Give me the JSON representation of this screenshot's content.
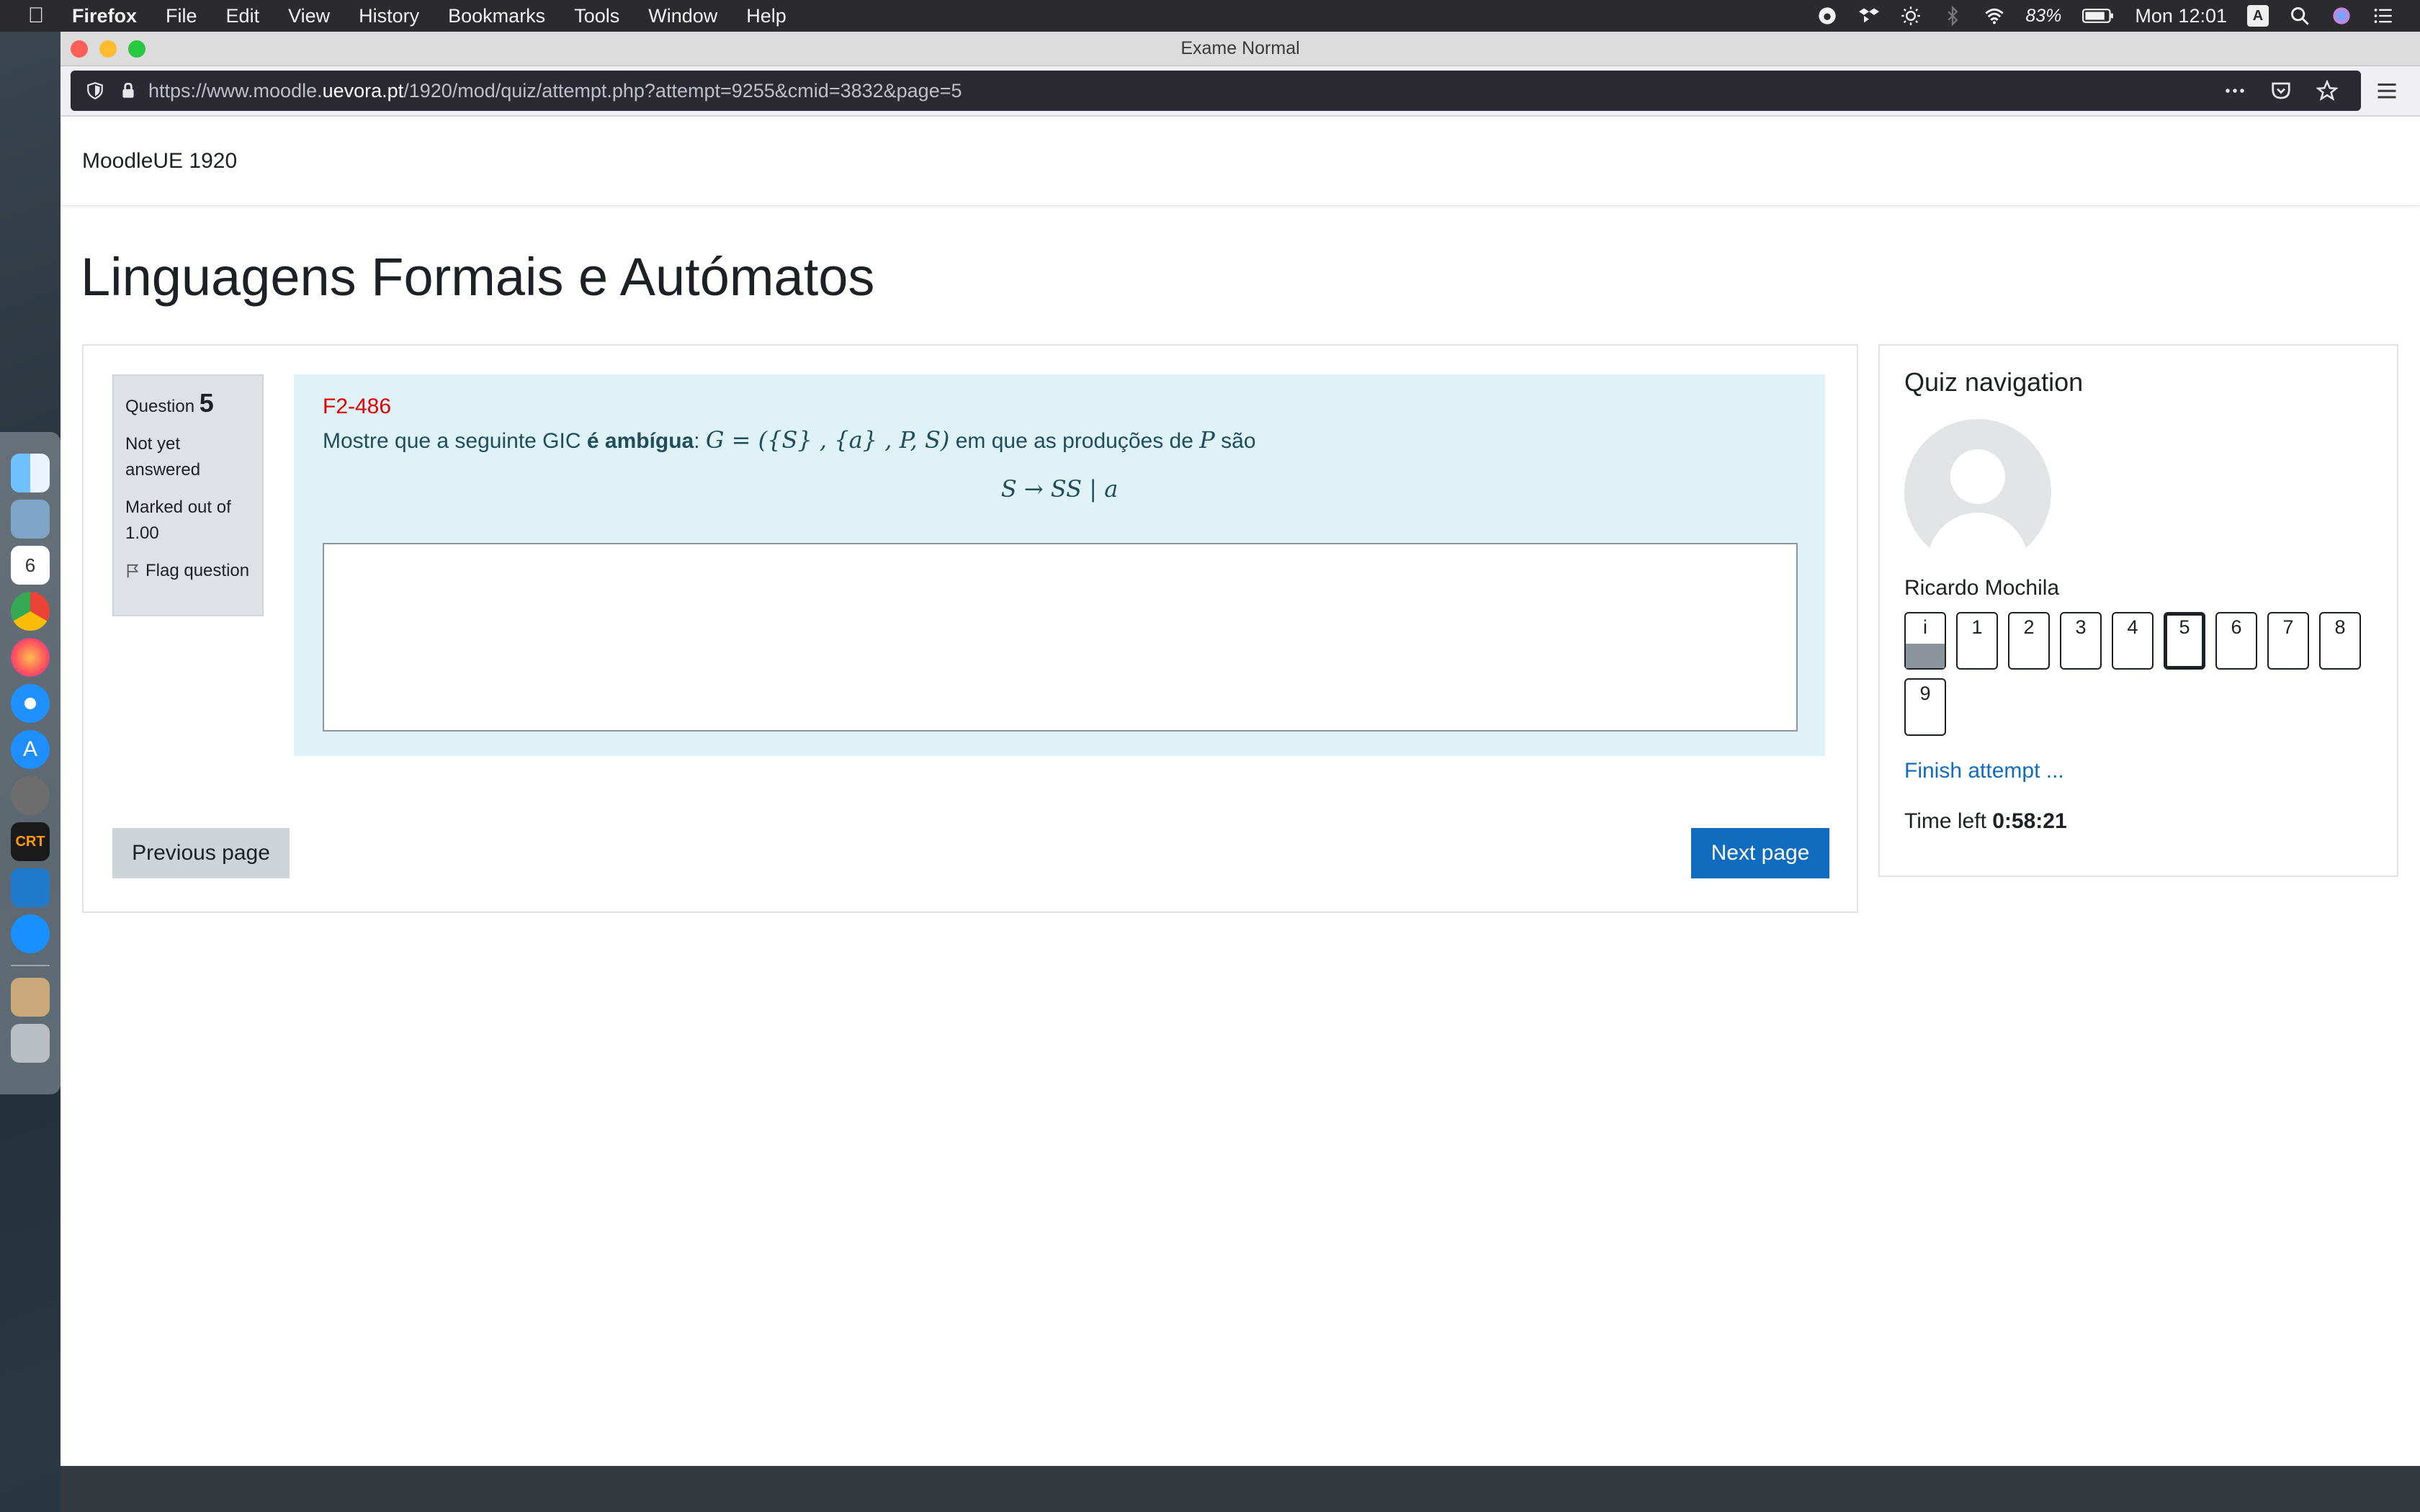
{
  "menubar": {
    "app": "Firefox",
    "items": [
      "File",
      "Edit",
      "View",
      "History",
      "Bookmarks",
      "Tools",
      "Window",
      "Help"
    ],
    "battery": "83%",
    "clock": "Mon 12:01",
    "input_badge": "A"
  },
  "window": {
    "title": "Exame Normal"
  },
  "url": {
    "prefix": "https://www.moodle.",
    "domain": "uevora.pt",
    "path": "/1920/mod/quiz/attempt.php?attempt=9255&cmid=3832&page=5"
  },
  "site": {
    "name": "MoodleUE 1920"
  },
  "course": {
    "title": "Linguagens Formais e Autómatos"
  },
  "question": {
    "label": "Question",
    "number": "5",
    "state": "Not yet answered",
    "marks": "Marked out of 1.00",
    "flag": "Flag question",
    "code": "F2-486",
    "text_pre": "Mostre que a seguinte GIC ",
    "text_bold": "é ambígua",
    "text_colon": ": ",
    "math_g": "G = ({S} , {a} , P, S)",
    "text_mid": " em que as produções de ",
    "math_p": "P",
    "text_post": " são",
    "formula": "S → SS | a",
    "answer_value": ""
  },
  "buttons": {
    "previous": "Previous page",
    "next": "Next page"
  },
  "quiznav": {
    "title": "Quiz navigation",
    "user": "Ricardo Mochila",
    "buttons": [
      "i",
      "1",
      "2",
      "3",
      "4",
      "5",
      "6",
      "7",
      "8",
      "9"
    ],
    "current": "5",
    "finish": "Finish attempt ...",
    "time_label": "Time left ",
    "time_value": "0:58:21"
  },
  "colors": {
    "accent": "#0f6cbf",
    "question_bg": "#def2f8",
    "question_code": "#e00000",
    "footer": "#343a40"
  }
}
